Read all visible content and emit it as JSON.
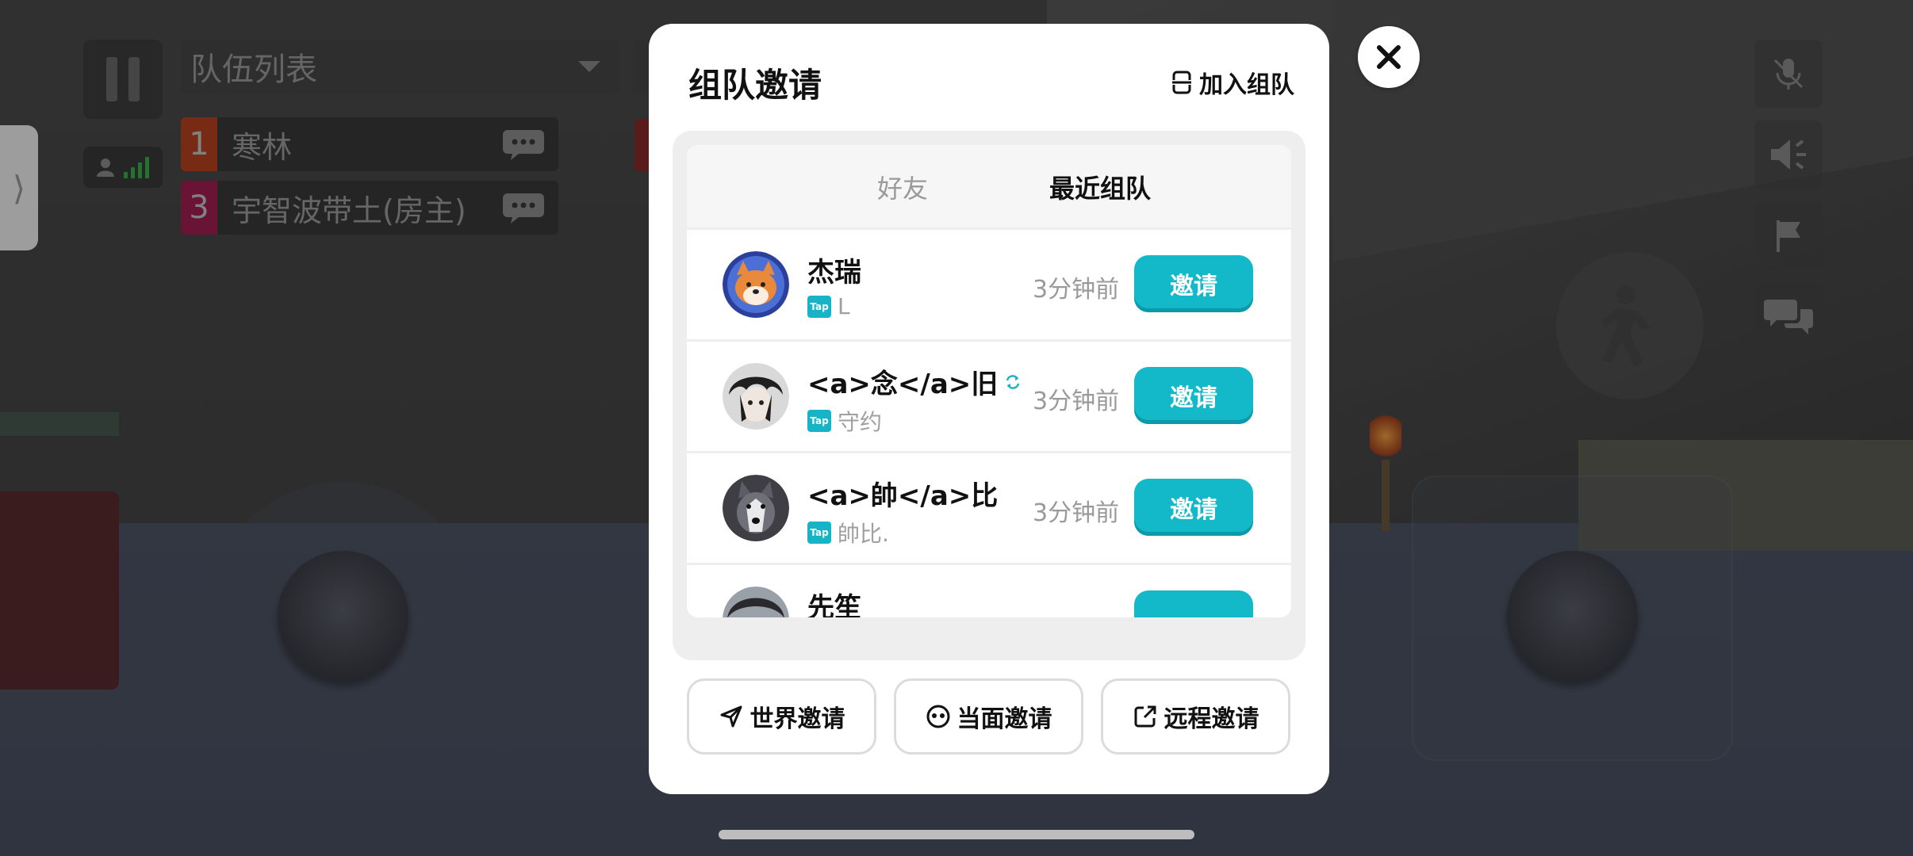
{
  "hud": {
    "team_list_title": "队伍列表",
    "members": [
      {
        "num": "1",
        "name": "寒林",
        "color": "#b8431f"
      },
      {
        "num": "3",
        "name": "宇智波带土(房主)",
        "color": "#a11e52"
      }
    ]
  },
  "dialog": {
    "title": "组队邀请",
    "join_team": "加入组队",
    "tabs": [
      {
        "label": "好友",
        "active": false
      },
      {
        "label": "最近组队",
        "active": true
      }
    ],
    "players": [
      {
        "name": "杰瑞",
        "sub": "L",
        "time": "3分钟前",
        "invite": "邀请",
        "avatar": "shiba-avatar"
      },
      {
        "name": "<a>念</a>旧",
        "sub": "守约",
        "time": "3分钟前",
        "invite": "邀请",
        "avatar": "anime-avatar"
      },
      {
        "name": "<a>帥</a>比",
        "sub": "帥比.",
        "time": "3分钟前",
        "invite": "邀请",
        "avatar": "husky-avatar"
      },
      {
        "name": "先笙",
        "sub": "",
        "time": "",
        "invite": "",
        "avatar": "dark-avatar"
      }
    ],
    "tap_label": "Tap",
    "bottom_buttons": [
      {
        "label": "世界邀请",
        "icon": "send-icon"
      },
      {
        "label": "当面邀请",
        "icon": "face-icon"
      },
      {
        "label": "远程邀请",
        "icon": "external-link-icon"
      }
    ]
  },
  "colors": {
    "accent": "#14b9c9",
    "tap": "#17b3c7"
  }
}
